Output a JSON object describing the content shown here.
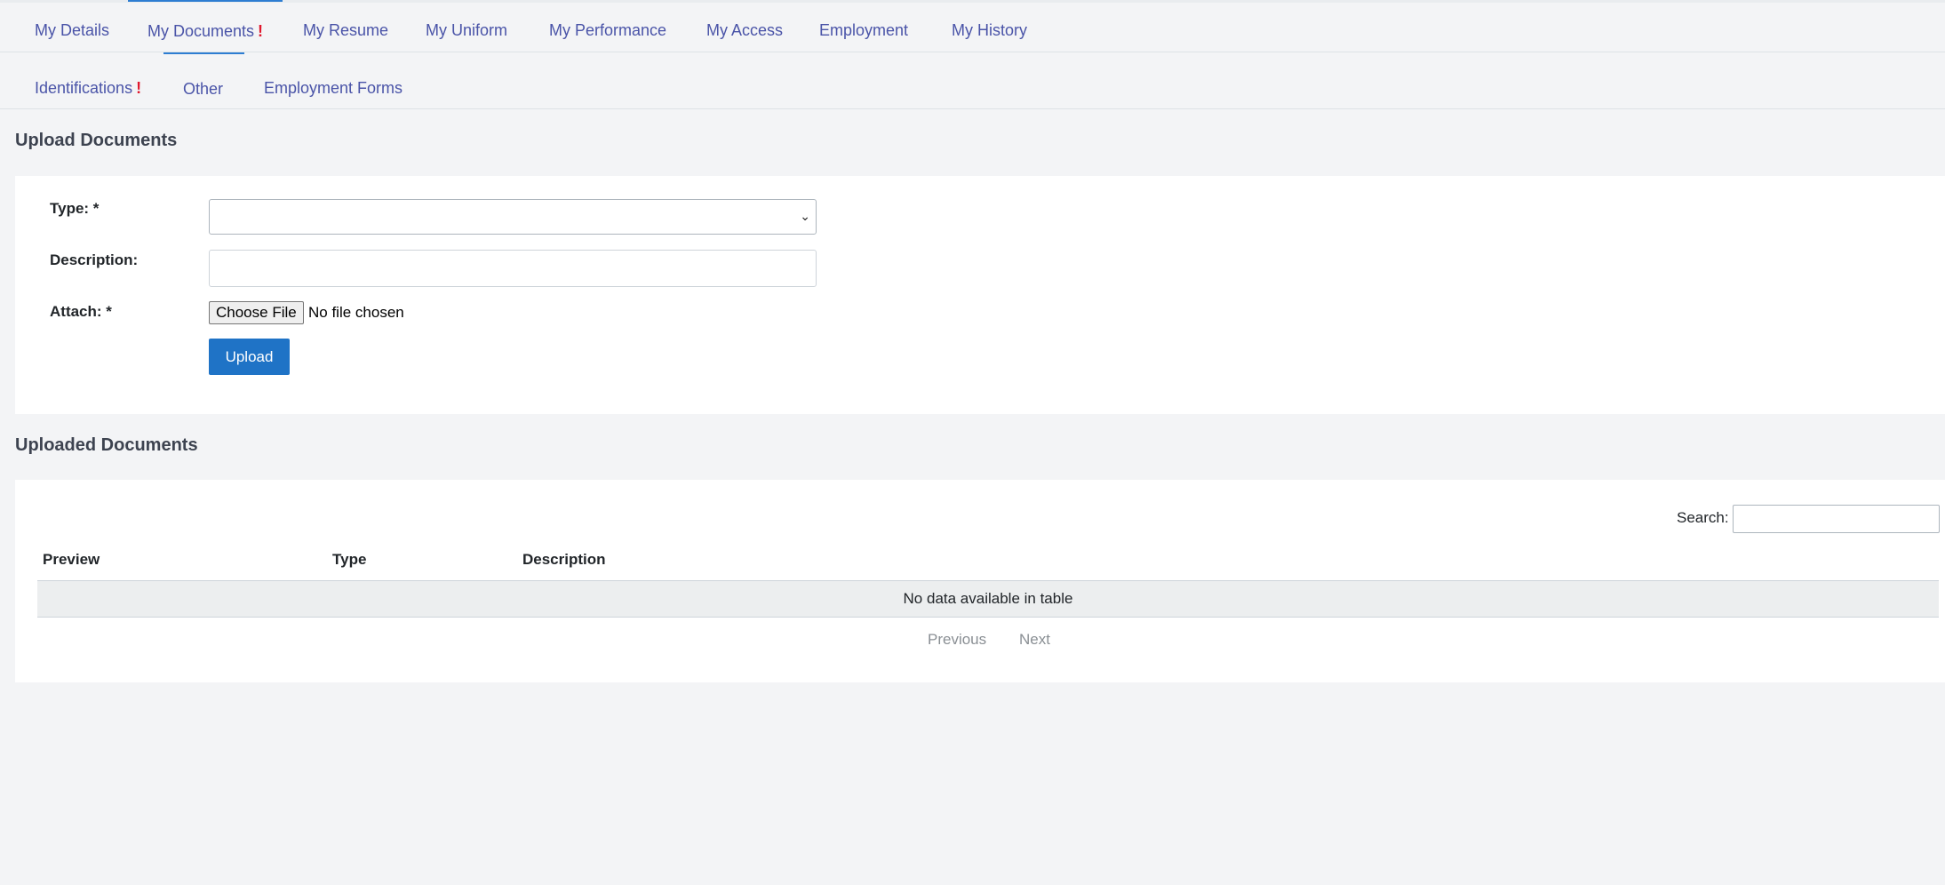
{
  "tabs": [
    {
      "label": "My Details",
      "alert": ""
    },
    {
      "label": "My Documents",
      "alert": "!"
    },
    {
      "label": "My Resume",
      "alert": ""
    },
    {
      "label": "My Uniform",
      "alert": ""
    },
    {
      "label": "My Performance",
      "alert": ""
    },
    {
      "label": "My Access",
      "alert": ""
    },
    {
      "label": "Employment",
      "alert": ""
    },
    {
      "label": "My History",
      "alert": ""
    }
  ],
  "active_tab": "My Documents",
  "subtabs": [
    {
      "label": "Identifications",
      "alert": "!"
    },
    {
      "label": "Other",
      "alert": ""
    },
    {
      "label": "Employment Forms",
      "alert": ""
    }
  ],
  "active_subtab": "Other",
  "upload": {
    "title": "Upload Documents",
    "type_label": "Type: *",
    "type_value": "",
    "description_label": "Description:",
    "description_value": "",
    "attach_label": "Attach: *",
    "choose_file_label": "Choose File",
    "file_status": "No file chosen",
    "upload_button": "Upload"
  },
  "uploaded": {
    "title": "Uploaded Documents",
    "search_label": "Search:",
    "search_value": "",
    "columns": [
      "Preview",
      "Type",
      "Description"
    ],
    "empty_message": "No data available in table",
    "previous_label": "Previous",
    "next_label": "Next"
  },
  "colors": {
    "accent": "#1f73c6",
    "tab_text": "#4a54a8",
    "alert": "#e0182d",
    "background": "#f3f4f6"
  }
}
